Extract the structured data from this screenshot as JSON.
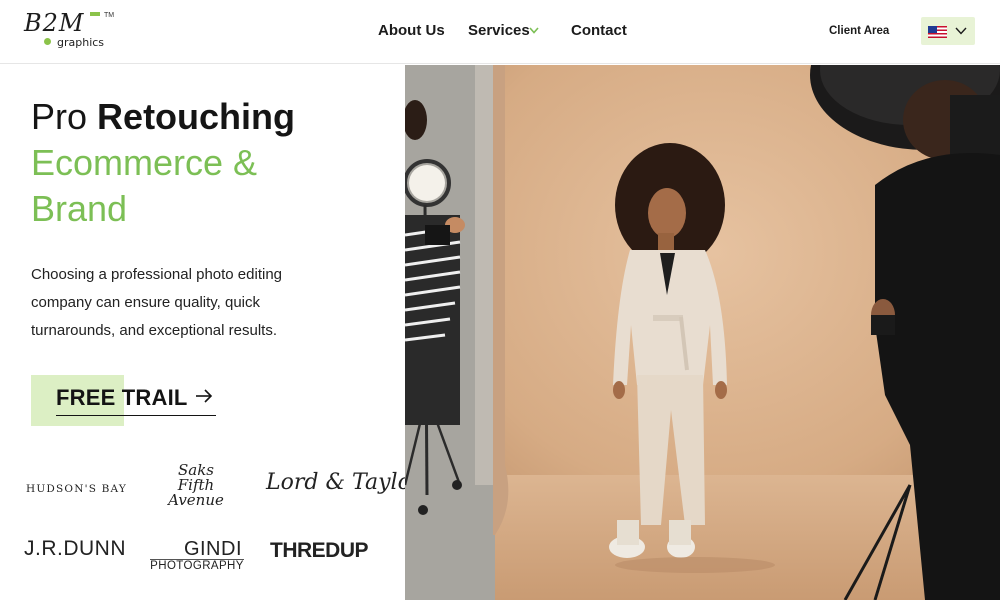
{
  "brand": {
    "name": "B2M",
    "sub": "graphics",
    "tm": "TM"
  },
  "nav": {
    "about": "About Us",
    "services": "Services",
    "contact": "Contact",
    "client_area": "Client Area"
  },
  "language": {
    "selected_flag": "us-flag-icon"
  },
  "hero": {
    "title_light": "Pro",
    "title_bold": "Retouching",
    "title_line2": "Ecommerce &",
    "title_line3": "Brand",
    "intro": "Choosing a professional photo editing company can ensure quality, quick turnarounds, and exceptional results.",
    "cta_label": "FREE TRAIL"
  },
  "clients": {
    "hudson": "HUDSON'S BAY",
    "saks_1": "Saks",
    "saks_2": "Fifth",
    "saks_3": "Avenue",
    "lord": "Lord & Taylor",
    "jrdunn": "J.R.DUNN",
    "gindi_1": "GINDI",
    "gindi_2": "PHOTOGRAPHY",
    "thredup": "THREDUP"
  },
  "colors": {
    "accent": "#7cbf55",
    "accent_light": "#dcefc4",
    "text": "#151515"
  }
}
